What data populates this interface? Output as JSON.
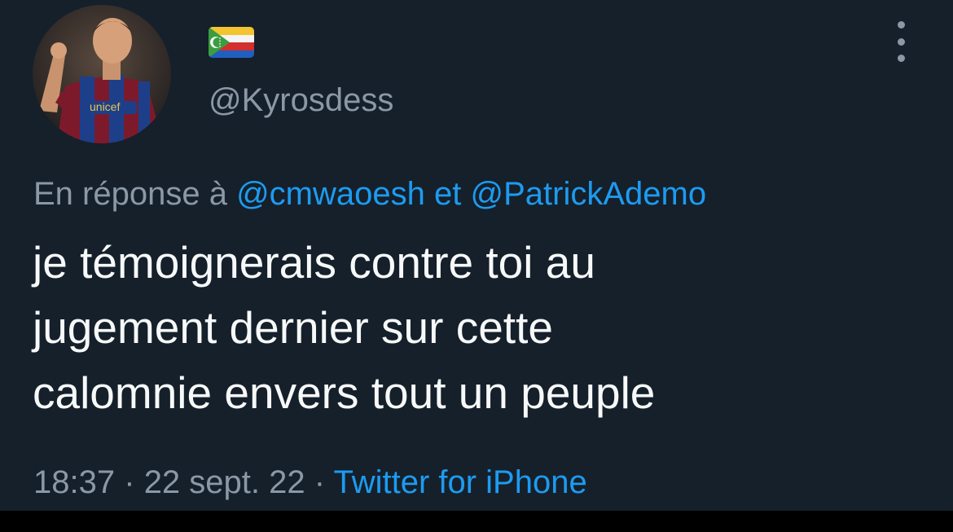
{
  "tweet": {
    "handle": "@Kyrosdess",
    "reply": {
      "prefix": "En réponse à",
      "mention_1": "@cmwaoesh",
      "conjunction": "et",
      "mention_2": "@PatrickAdemo"
    },
    "body_lines": [
      "je témoignerais contre toi au",
      "jugement dernier sur cette",
      "calomnie envers tout un peuple"
    ],
    "meta": {
      "time": "18:37",
      "separator": "·",
      "date": "22 sept. 22",
      "source": "Twitter for iPhone"
    }
  },
  "avatar": {
    "shirt_text": "unicef"
  },
  "icons": {
    "more": "more-vertical-icon",
    "flag": "comoros-flag-icon"
  },
  "colors": {
    "background": "#15202b",
    "text": "#f7f9f9",
    "secondary": "#8b98a5",
    "link": "#1d9bf0"
  }
}
